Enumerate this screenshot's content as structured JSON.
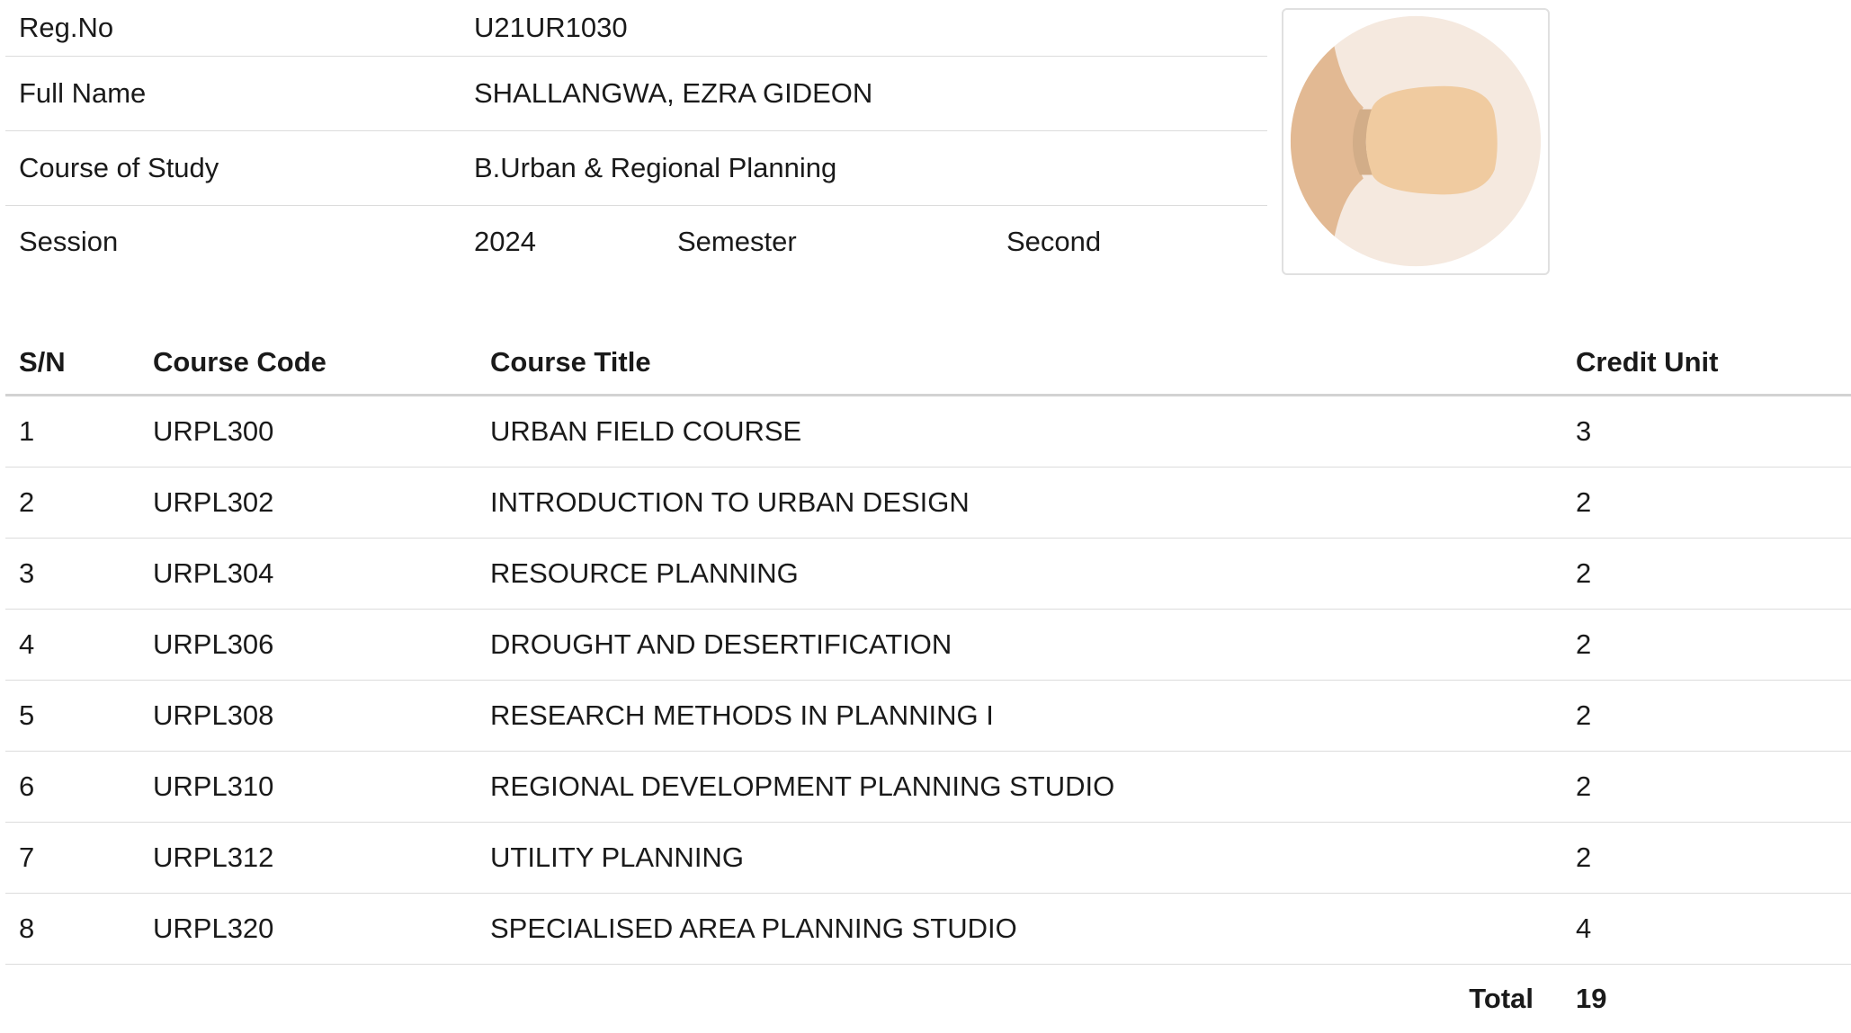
{
  "student": {
    "reg_label": "Reg.No",
    "reg_value": "U21UR1030",
    "name_label": "Full Name",
    "name_value": "SHALLANGWA, EZRA GIDEON",
    "course_label": "Course of Study",
    "course_value": "B.Urban & Regional Planning",
    "session_label": "Session",
    "session_value": "2024",
    "semester_label": "Semester",
    "semester_value": "Second"
  },
  "photo": {
    "icon": "student-photo-placeholder",
    "bg": "#f5e9df",
    "skin_light": "#f0cba0",
    "skin_dark": "#e2b993"
  },
  "courses": {
    "headers": {
      "sn": "S/N",
      "code": "Course Code",
      "title": "Course Title",
      "credit": "Credit Unit"
    },
    "rows": [
      {
        "sn": "1",
        "code": "URPL300",
        "title": "URBAN FIELD COURSE",
        "credit": "3"
      },
      {
        "sn": "2",
        "code": "URPL302",
        "title": "INTRODUCTION TO URBAN DESIGN",
        "credit": "2"
      },
      {
        "sn": "3",
        "code": "URPL304",
        "title": "RESOURCE PLANNING",
        "credit": "2"
      },
      {
        "sn": "4",
        "code": "URPL306",
        "title": "DROUGHT AND DESERTIFICATION",
        "credit": "2"
      },
      {
        "sn": "5",
        "code": "URPL308",
        "title": "RESEARCH METHODS IN PLANNING I",
        "credit": "2"
      },
      {
        "sn": "6",
        "code": "URPL310",
        "title": "REGIONAL DEVELOPMENT PLANNING STUDIO",
        "credit": "2"
      },
      {
        "sn": "7",
        "code": "URPL312",
        "title": "UTILITY PLANNING",
        "credit": "2"
      },
      {
        "sn": "8",
        "code": "URPL320",
        "title": "SPECIALISED AREA PLANNING STUDIO",
        "credit": "4"
      }
    ],
    "total_label": "Total",
    "total_value": "19"
  }
}
